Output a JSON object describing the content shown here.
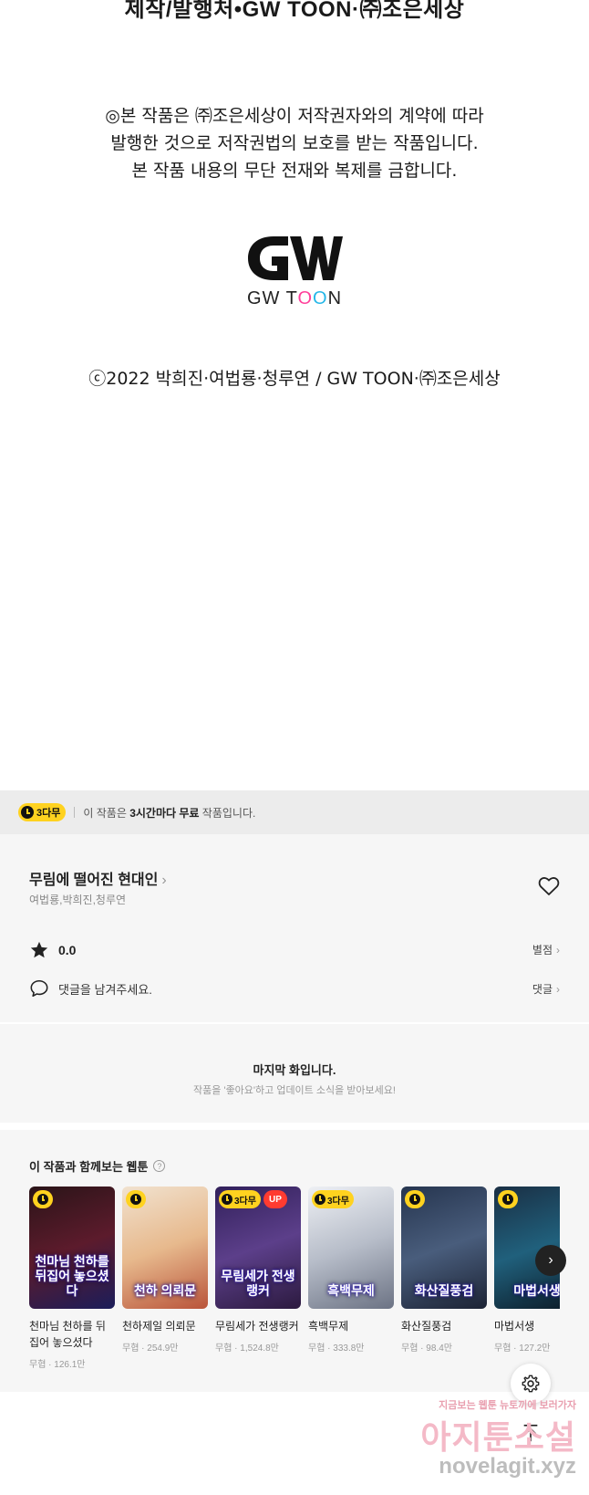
{
  "comic_page": {
    "credit_top": "제작/발행처•GW TOON·㈜조은세상",
    "notice_lines": [
      "◎본 작품은 ㈜조은세상이 저작권자와의 계약에 따라",
      "발행한 것으로 저작권법의 보호를 받는 작품입니다.",
      "본 작품 내용의 무단 전재와 복제를 금합니다."
    ],
    "logo_text_parts": [
      "GW T",
      "O",
      "O",
      "N"
    ],
    "copyright": "ⓒ2022 박희진·여법룡·청루연 / GW TOON·㈜조은세상"
  },
  "free_banner": {
    "badge": "3다무",
    "text_before": "이 작품은 ",
    "text_bold": "3시간마다 무료",
    "text_after": " 작품입니다."
  },
  "work_info": {
    "title": "무림에 떨어진 현대인",
    "title_chevron": "›",
    "authors": "여법룡,박희진,청루연",
    "rating": "0.0",
    "rating_link": "별점",
    "comment_placeholder": "댓글을 남겨주세요.",
    "comment_link": "댓글",
    "chevron": "›"
  },
  "last_episode": {
    "title": "마지막 화입니다.",
    "subtitle": "작품을 '좋아요'하고 업데이트 소식을 받아보세요!"
  },
  "recommendations": {
    "title": "이 작품과 함께보는 웹툰",
    "help_icon": "?",
    "next_icon": "›",
    "items": [
      {
        "name": "천마님 천하를 뒤집어 놓으셨다",
        "genre": "무협",
        "views": "126.1만",
        "art_title": "천마님 천하를 뒤집어 놓으셨다",
        "badges": [
          "clock"
        ],
        "bg": [
          "#2a1418",
          "#5c1b2c",
          "#1b1d5a"
        ]
      },
      {
        "name": "천하제일 의뢰문",
        "genre": "무협",
        "views": "254.9만",
        "art_title": "천하 의뢰문",
        "badges": [
          "clock"
        ],
        "bg": [
          "#f1e2cf",
          "#e7b98d",
          "#b9543a"
        ]
      },
      {
        "name": "무림세가 전생랭커",
        "genre": "무협",
        "views": "1,524.8만",
        "art_title": "무림세가 전생랭커",
        "badges": [
          "3다무",
          "UP"
        ],
        "bg": [
          "#31205a",
          "#5c3f8a",
          "#2c1a3f"
        ]
      },
      {
        "name": "흑백무제",
        "genre": "무협",
        "views": "333.8만",
        "art_title": "흑백무제",
        "badges": [
          "3다무"
        ],
        "bg": [
          "#eef0f4",
          "#b7bdc9",
          "#6c7384"
        ]
      },
      {
        "name": "화산질풍검",
        "genre": "무협",
        "views": "98.4만",
        "art_title": "화산질풍검",
        "badges": [
          "clock"
        ],
        "bg": [
          "#26354f",
          "#495d7c",
          "#1c2334"
        ]
      },
      {
        "name": "마법서생",
        "genre": "무협",
        "views": "127.2만",
        "art_title": "마법서생",
        "badges": [
          "clock"
        ],
        "bg": [
          "#1a2f44",
          "#20607c",
          "#0c1a26"
        ]
      }
    ]
  },
  "floating": {
    "settings_icon": "gear-icon",
    "top_icon": "arrow-up-icon"
  },
  "watermark": {
    "line1": "지금보는 웹툰 뉴토끼에 보러가자",
    "line2": "아지툰소설",
    "line3": "novelagit.xyz"
  },
  "colors": {
    "free_badge": "#ffd21f",
    "up_badge": "#ff3b30",
    "section_bg": "#f6f6f6"
  }
}
